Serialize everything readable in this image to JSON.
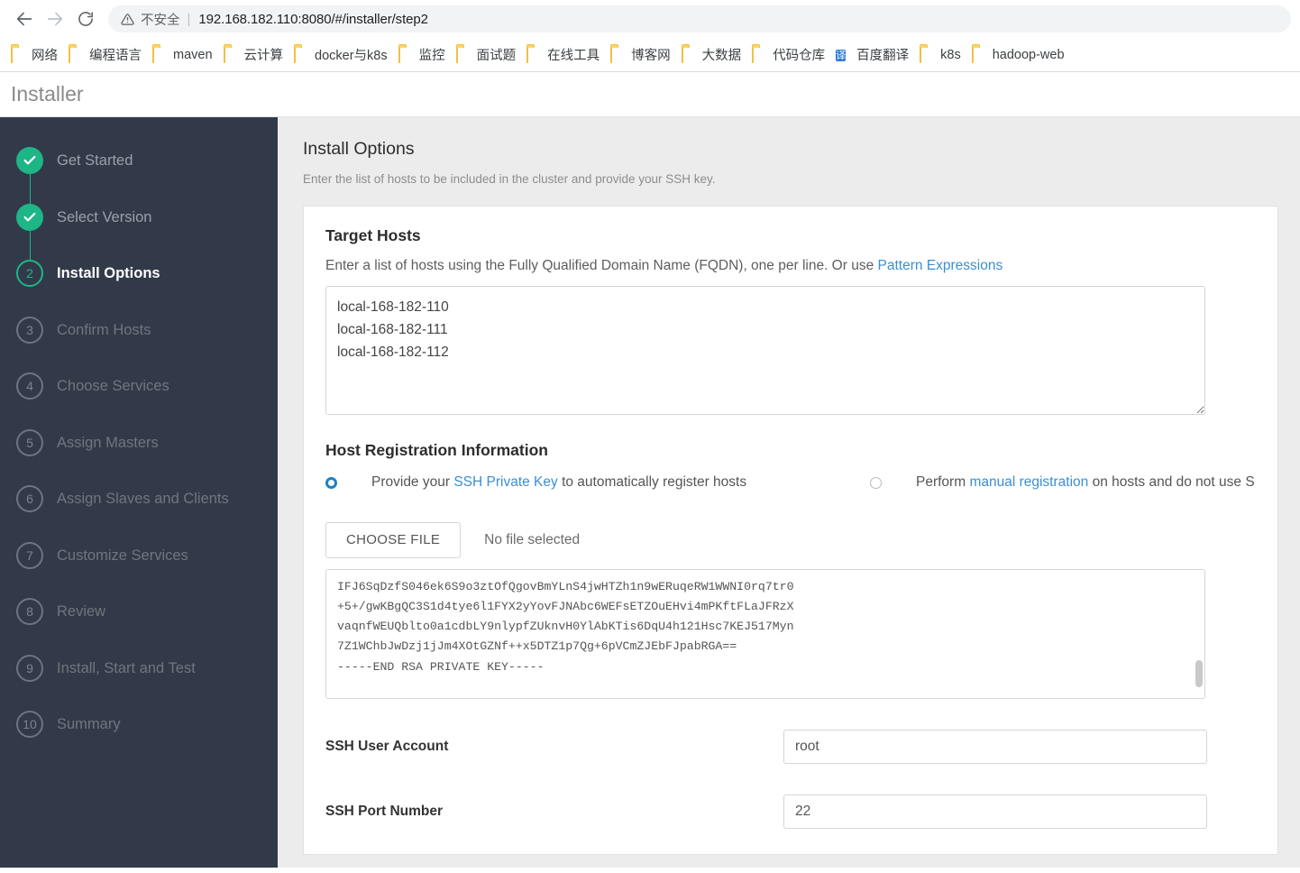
{
  "browser": {
    "back_icon": "arrow-left-icon",
    "forward_icon": "arrow-right-icon",
    "reload_icon": "reload-icon",
    "security_warning": "不安全",
    "url": "192.168.182.110:8080/#/installer/step2",
    "bookmarks": [
      {
        "label": "网络",
        "icon": "folder-icon"
      },
      {
        "label": "编程语言",
        "icon": "folder-icon"
      },
      {
        "label": "maven",
        "icon": "folder-icon"
      },
      {
        "label": "云计算",
        "icon": "folder-icon"
      },
      {
        "label": "docker与k8s",
        "icon": "folder-icon"
      },
      {
        "label": "监控",
        "icon": "folder-icon"
      },
      {
        "label": "面试题",
        "icon": "folder-icon"
      },
      {
        "label": "在线工具",
        "icon": "folder-icon"
      },
      {
        "label": "博客网",
        "icon": "folder-icon"
      },
      {
        "label": "大数据",
        "icon": "folder-icon"
      },
      {
        "label": "代码仓库",
        "icon": "folder-icon"
      },
      {
        "label": "百度翻译",
        "icon": "translate-icon",
        "icon_text": "译"
      },
      {
        "label": "k8s",
        "icon": "folder-icon"
      },
      {
        "label": "hadoop-web",
        "icon": "folder-icon"
      }
    ]
  },
  "app": {
    "title": "Installer"
  },
  "sidebar": {
    "steps": [
      {
        "num": "1",
        "label": "Get Started",
        "state": "done"
      },
      {
        "num": "2",
        "label": "Select Version",
        "state": "done"
      },
      {
        "num": "2",
        "label": "Install Options",
        "state": "current"
      },
      {
        "num": "3",
        "label": "Confirm Hosts",
        "state": "todo"
      },
      {
        "num": "4",
        "label": "Choose Services",
        "state": "todo"
      },
      {
        "num": "5",
        "label": "Assign Masters",
        "state": "todo"
      },
      {
        "num": "6",
        "label": "Assign Slaves and Clients",
        "state": "todo"
      },
      {
        "num": "7",
        "label": "Customize Services",
        "state": "todo"
      },
      {
        "num": "8",
        "label": "Review",
        "state": "todo"
      },
      {
        "num": "9",
        "label": "Install, Start and Test",
        "state": "todo"
      },
      {
        "num": "10",
        "label": "Summary",
        "state": "todo"
      }
    ]
  },
  "main": {
    "page_title": "Install Options",
    "page_subtitle": "Enter the list of hosts to be included in the cluster and provide your SSH key.",
    "target_hosts": {
      "title": "Target Hosts",
      "helper_before": "Enter a list of hosts using the Fully Qualified Domain Name (FQDN), one per line. Or use ",
      "helper_link": "Pattern Expressions",
      "value": "local-168-182-110\nlocal-168-182-111\nlocal-168-182-112"
    },
    "host_registration": {
      "title": "Host Registration Information",
      "option_ssh": {
        "text_before": "Provide your ",
        "link": "SSH Private Key",
        "text_after": " to automatically register hosts",
        "selected": true
      },
      "option_manual": {
        "text_before": "Perform ",
        "link": "manual registration",
        "text_after": " on hosts and do not use S",
        "selected": false
      },
      "choose_file_label": "CHOOSE FILE",
      "file_status": "No file selected",
      "ssh_key_value": "IFJ6SqDzfS046ek6S9o3ztOfQgovBmYLnS4jwHTZh1n9wERuqeRW1WWNI0rq7tr0\n+5+/gwKBgQC3S1d4tye6l1FYX2yYovFJNAbc6WEFsETZOuEHvi4mPKftFLaJFRzX\nvaqnfWEUQblto0a1cdbLY9nlypfZUknvH0YlAbKTis6DqU4h121Hsc7KEJ517Myn\n7Z1WChbJwDzj1jJm4XOtGZNf++x5DTZ1p7Qg+6pVCmZJEbFJpabRGA==\n-----END RSA PRIVATE KEY-----"
    },
    "ssh_user": {
      "label": "SSH User Account",
      "value": "root"
    },
    "ssh_port": {
      "label": "SSH Port Number",
      "value": "22"
    }
  }
}
